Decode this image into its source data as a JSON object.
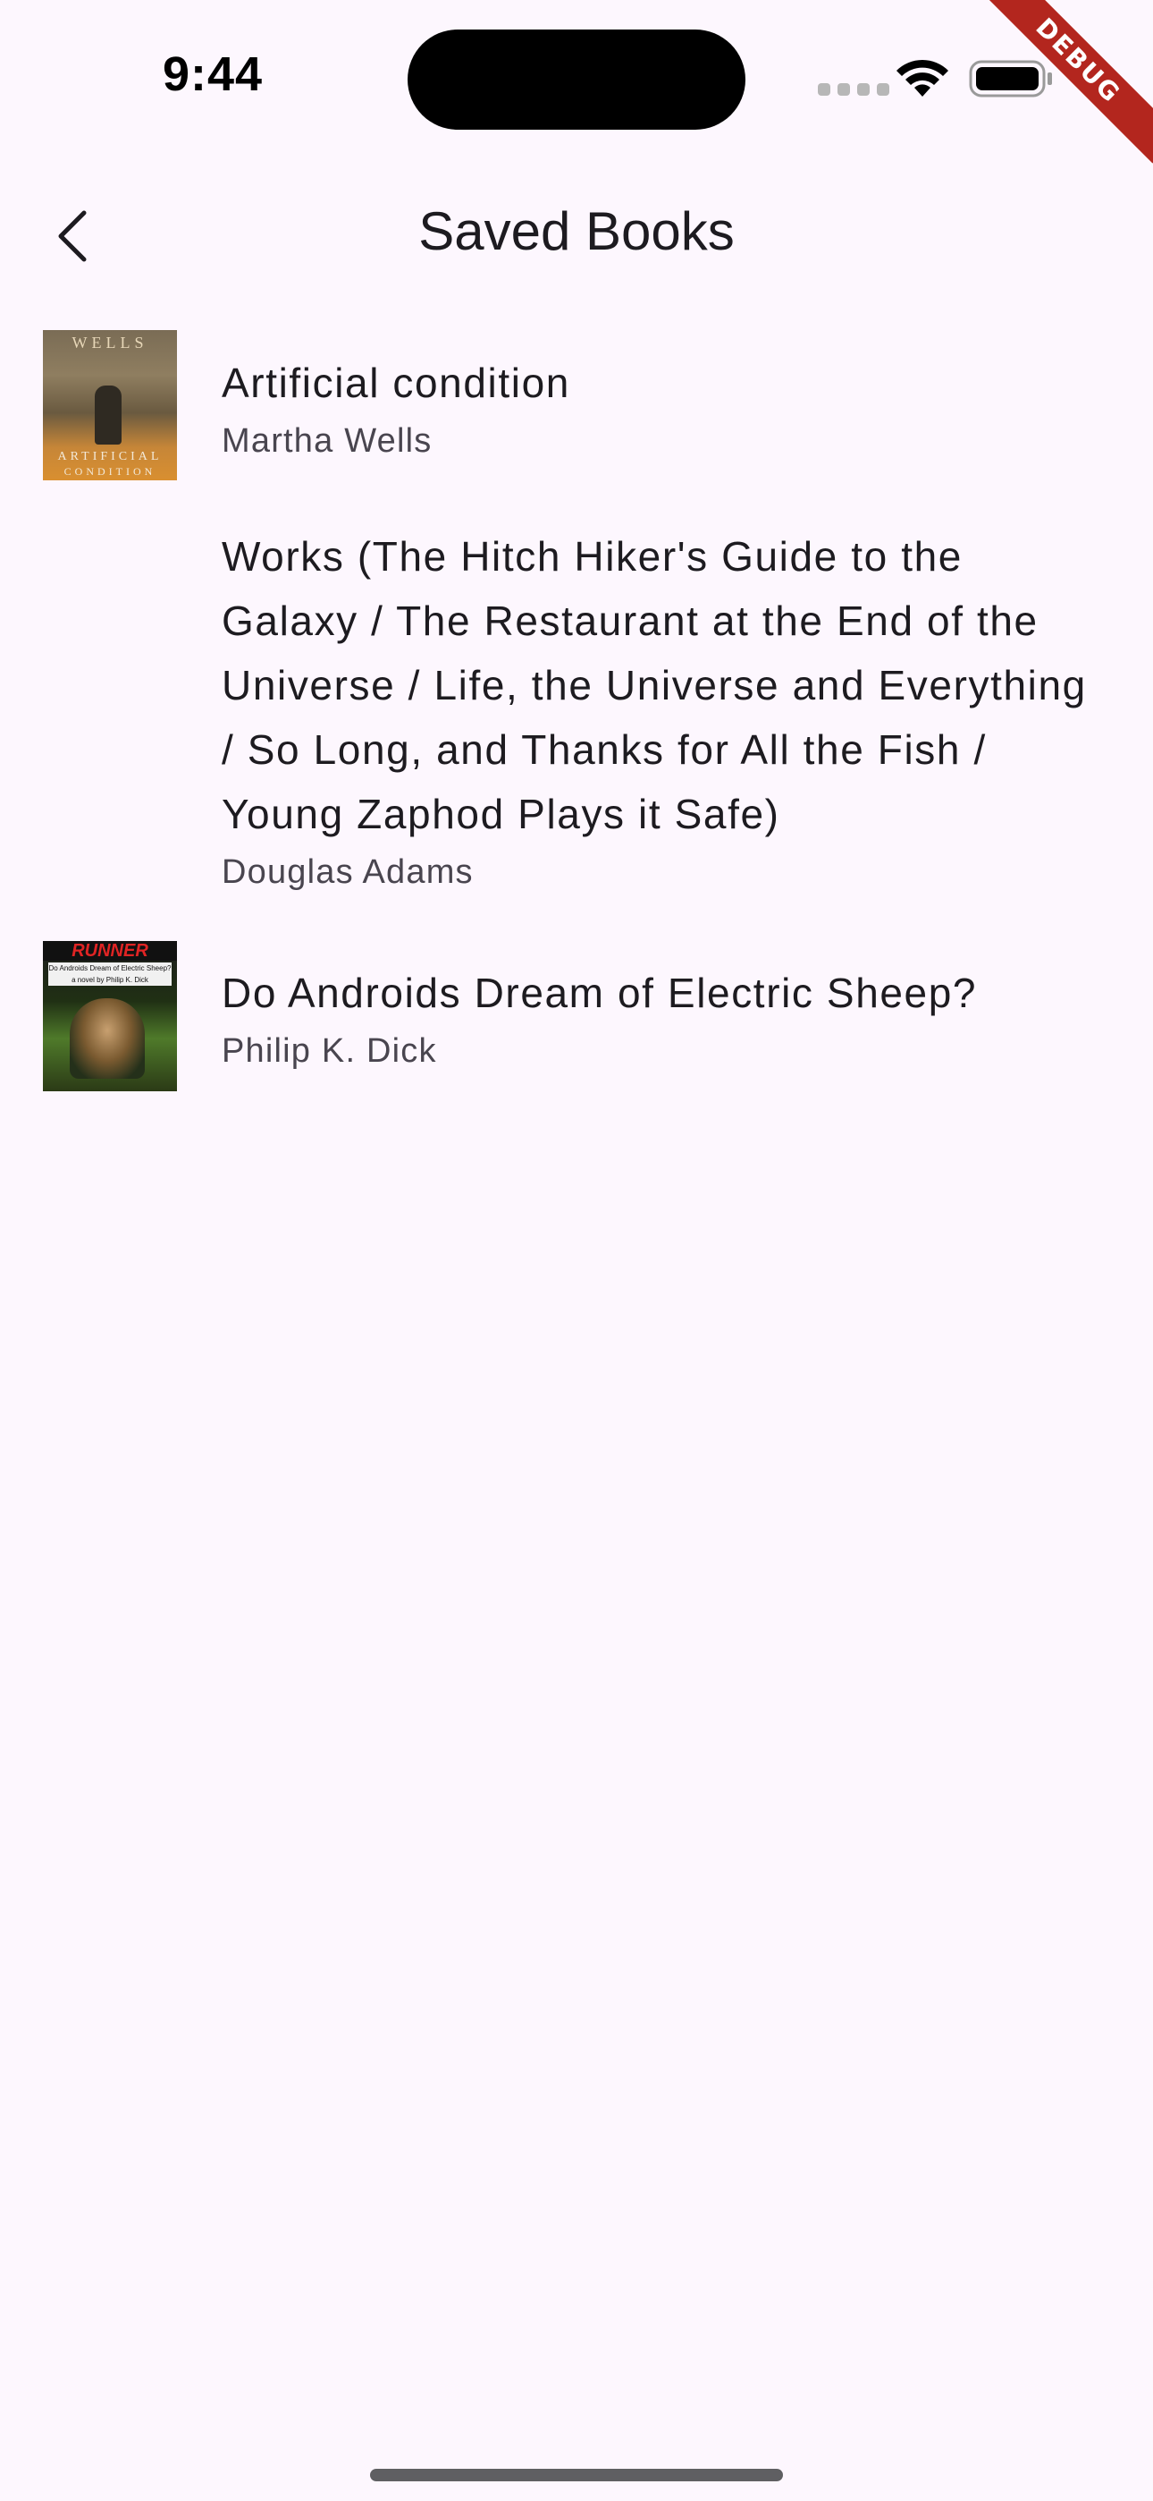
{
  "status_bar": {
    "time": "9:44"
  },
  "debug_banner": {
    "label": "DEBUG"
  },
  "app_bar": {
    "title": "Saved Books",
    "back_icon": "chevron-left-icon"
  },
  "books": [
    {
      "title": "Artificial condition",
      "author": "Martha Wells",
      "cover": {
        "author_text": "WELLS",
        "title_text": "ARTIFICIAL",
        "subtitle_text": "CONDITION"
      }
    },
    {
      "title": "Works (The Hitch Hiker's Guide to the Galaxy / The Restaurant at the End of the Universe / Life, the Universe and Everything / So Long, and Thanks for All the Fish / Young Zaphod Plays it Safe)",
      "author": "Douglas Adams"
    },
    {
      "title": "Do Androids Dream of Electric Sheep?",
      "author": "Philip K. Dick",
      "cover": {
        "head_text": "RUNNER",
        "band_text": "Do Androids Dream of Electric Sheep? a novel by Philip K. Dick"
      }
    }
  ],
  "colors": {
    "background": "#FDF7FE",
    "title_text": "#1D1B20",
    "subtitle_text": "#49454F",
    "debug_banner": "#B3261E"
  }
}
